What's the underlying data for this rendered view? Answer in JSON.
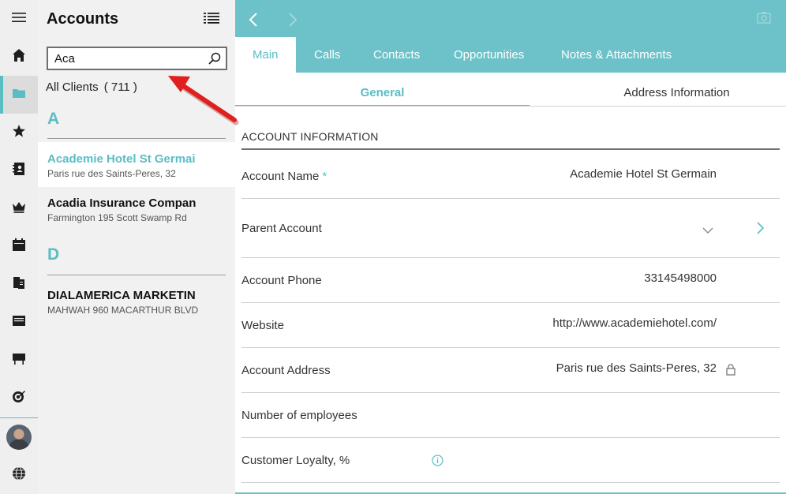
{
  "sidebar": {
    "icons": [
      "menu-icon",
      "home-icon",
      "folder-icon",
      "star-icon",
      "contacts-book-icon",
      "crown-icon",
      "calendar-icon",
      "documents-icon",
      "inbox-icon",
      "presentation-icon",
      "target-icon",
      "user-avatar",
      "globe-icon"
    ]
  },
  "accounts": {
    "title": "Accounts",
    "search": {
      "value": "Aca",
      "placeholder": ""
    },
    "filter": {
      "label": "All Clients",
      "count": "( 711 )"
    },
    "groups": [
      {
        "letter": "A",
        "items": [
          {
            "name": "Academie Hotel St Germain",
            "address": "Paris rue des Saints-Peres, 32",
            "selected": true
          },
          {
            "name": "Acadia Insurance Company",
            "address": "Farmington 195 Scott Swamp Rd",
            "selected": false
          }
        ]
      },
      {
        "letter": "D",
        "items": [
          {
            "name": "DIALAMERICA MARKETING",
            "address": "MAHWAH 960 MACARTHUR BLVD",
            "selected": false
          }
        ]
      }
    ]
  },
  "header": {
    "tabs": [
      {
        "label": "Main",
        "active": true
      },
      {
        "label": "Calls",
        "active": false
      },
      {
        "label": "Contacts",
        "active": false
      },
      {
        "label": "Opportunities",
        "active": false
      },
      {
        "label": "Notes & Attachments",
        "active": false
      }
    ]
  },
  "subtabs": [
    {
      "label": "General",
      "active": true
    },
    {
      "label": "Address Information",
      "active": false
    }
  ],
  "form": {
    "section_title": "ACCOUNT INFORMATION",
    "fields": [
      {
        "label": "Account Name",
        "required_mark": "*",
        "value": "Academie Hotel St Germain"
      },
      {
        "label": "Parent Account",
        "value": ""
      },
      {
        "label": "Account Phone",
        "value": "33145498000"
      },
      {
        "label": "Website",
        "value": "http://www.academiehotel.com/"
      },
      {
        "label": "Account Address",
        "value": "Paris rue des Saints-Peres, 32"
      },
      {
        "label": "Number of employees",
        "value": ""
      },
      {
        "label": "Customer Loyalty, %",
        "value": ""
      }
    ]
  },
  "colors": {
    "accent": "#5bbdc4",
    "header": "#6cc2c8",
    "annotation_arrow": "#e0201c"
  }
}
